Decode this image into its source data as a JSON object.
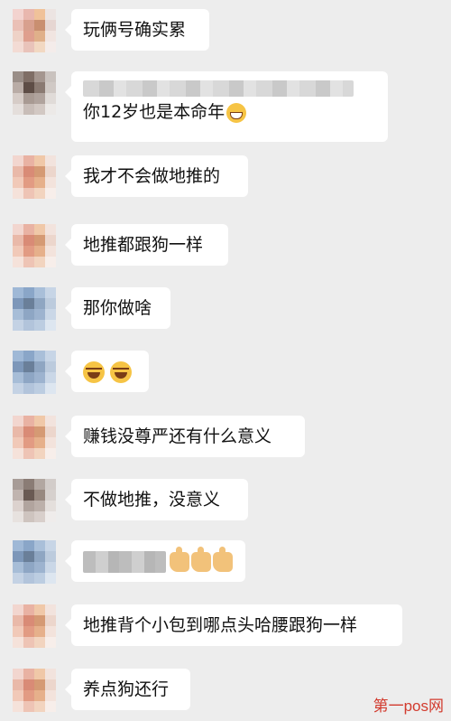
{
  "chat": {
    "messages": [
      {
        "text": "玩俩号确实累",
        "avatar": [
          "#f3d3cf",
          "#e9b7ae",
          "#f0c29a",
          "#ece4e2",
          "#eac0b6",
          "#d8a08e",
          "#c98f70",
          "#e6d6d2",
          "#eed2c7",
          "#df9f8e",
          "#e0b08a",
          "#f1e5e1",
          "#f3dbd4",
          "#e9c3ba",
          "#f2d8c2",
          "#f4ecea"
        ]
      },
      {
        "text": "你12岁也是本命年",
        "quote": true,
        "avatar": [
          "#9a8e88",
          "#7f6e66",
          "#a4968f",
          "#c9c2be",
          "#b9aca6",
          "#5e4d46",
          "#8a7a72",
          "#d0c9c5",
          "#d6ccc7",
          "#a89a93",
          "#b0a39d",
          "#e0dbd8",
          "#e4dedb",
          "#c8bdb8",
          "#d2c8c3",
          "#ece9e7"
        ]
      },
      {
        "text": "我才不会做地推的",
        "avatar": [
          "#f2d6cf",
          "#e9b2a3",
          "#f0c8a8",
          "#f2e3dd",
          "#e9b9a9",
          "#d98b76",
          "#d59a74",
          "#ecd6cc",
          "#f1c9b8",
          "#e29b83",
          "#e6b08b",
          "#f3e3dc",
          "#f5e2da",
          "#eec4b5",
          "#f2d4bf",
          "#f7eeea"
        ]
      },
      {
        "text": "地推都跟狗一样",
        "avatar": [
          "#f2d6cf",
          "#e9b2a3",
          "#f0c8a8",
          "#f2e3dd",
          "#e9b9a9",
          "#d98b76",
          "#d59a74",
          "#ecd6cc",
          "#f1c9b8",
          "#e29b83",
          "#e6b08b",
          "#f3e3dc",
          "#f5e2da",
          "#eec4b5",
          "#f2d4bf",
          "#f7eeea"
        ]
      },
      {
        "text": "那你做啥",
        "avatar": [
          "#9fb8d6",
          "#8aa6c8",
          "#a9bfd9",
          "#c7d5e6",
          "#7d97b9",
          "#6a7f99",
          "#8fa6c2",
          "#bccbdd",
          "#a7bdd7",
          "#8ea6c4",
          "#9db3cf",
          "#cad7e7",
          "#c4d2e4",
          "#b2c4db",
          "#bccde1",
          "#dde6f0"
        ]
      },
      {
        "text": "",
        "emoji_laugh": 2,
        "avatar": [
          "#9fb8d6",
          "#8aa6c8",
          "#a9bfd9",
          "#c7d5e6",
          "#7d97b9",
          "#6a7f99",
          "#8fa6c2",
          "#bccbdd",
          "#a7bdd7",
          "#8ea6c4",
          "#9db3cf",
          "#cad7e7",
          "#c4d2e4",
          "#b2c4db",
          "#bccde1",
          "#dde6f0"
        ]
      },
      {
        "text": "赚钱没尊严还有什么意义",
        "avatar": [
          "#f2d6cf",
          "#e9b2a3",
          "#f0c8a8",
          "#f2e3dd",
          "#e9b9a9",
          "#d98b76",
          "#d59a74",
          "#ecd6cc",
          "#f1c9b8",
          "#e29b83",
          "#e6b08b",
          "#f3e3dc",
          "#f5e2da",
          "#eec4b5",
          "#f2d4bf",
          "#f7eeea"
        ]
      },
      {
        "text": "不做地推，没意义",
        "avatar": [
          "#a79c97",
          "#8a7c75",
          "#b2a7a1",
          "#d2ccc9",
          "#c0b4af",
          "#6a5a53",
          "#988980",
          "#d6d0cd",
          "#dcd2ce",
          "#b1a49e",
          "#bcb0aa",
          "#e4dfdc",
          "#e7e2df",
          "#cec4bf",
          "#d8cfcb",
          "#efeceb"
        ]
      },
      {
        "text": "",
        "blur_name": true,
        "emoji_thumb": 3,
        "avatar": [
          "#9fb8d6",
          "#8aa6c8",
          "#a9bfd9",
          "#c7d5e6",
          "#7d97b9",
          "#6a7f99",
          "#8fa6c2",
          "#bccbdd",
          "#a7bdd7",
          "#8ea6c4",
          "#9db3cf",
          "#cad7e7",
          "#c4d2e4",
          "#b2c4db",
          "#bccde1",
          "#dde6f0"
        ]
      },
      {
        "text": "地推背个小包到哪点头哈腰跟狗一样",
        "avatar": [
          "#f2d6cf",
          "#e9b2a3",
          "#f0c8a8",
          "#f2e3dd",
          "#e9b9a9",
          "#d98b76",
          "#d59a74",
          "#ecd6cc",
          "#f1c9b8",
          "#e29b83",
          "#e6b08b",
          "#f3e3dc",
          "#f5e2da",
          "#eec4b5",
          "#f2d4bf",
          "#f7eeea"
        ]
      },
      {
        "text": "养点狗还行",
        "avatar": [
          "#f2d6cf",
          "#e9b2a3",
          "#f0c8a8",
          "#f2e3dd",
          "#e9b9a9",
          "#d98b76",
          "#d59a74",
          "#ecd6cc",
          "#f1c9b8",
          "#e29b83",
          "#e6b08b",
          "#f3e3dc",
          "#f5e2da",
          "#eec4b5",
          "#f2d4bf",
          "#f7eeea"
        ]
      }
    ]
  },
  "watermark": "第一pos网"
}
